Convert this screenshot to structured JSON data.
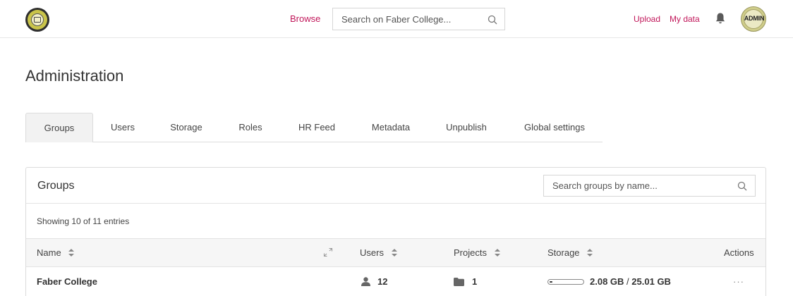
{
  "header": {
    "logo_icon": "college-seal-logo",
    "browse_label": "Browse",
    "search_placeholder": "Search on Faber College...",
    "upload_label": "Upload",
    "mydata_label": "My data",
    "avatar_text": "ADMIN"
  },
  "page": {
    "title": "Administration"
  },
  "tabs": [
    {
      "label": "Groups",
      "active": true
    },
    {
      "label": "Users"
    },
    {
      "label": "Storage"
    },
    {
      "label": "Roles"
    },
    {
      "label": "HR Feed"
    },
    {
      "label": "Metadata"
    },
    {
      "label": "Unpublish"
    },
    {
      "label": "Global settings"
    }
  ],
  "groups_panel": {
    "title": "Groups",
    "search_placeholder": "Search groups by name...",
    "entries_text": "Showing 10 of 11 entries",
    "columns": {
      "name": "Name",
      "users": "Users",
      "projects": "Projects",
      "storage": "Storage",
      "actions": "Actions"
    },
    "rows": [
      {
        "name": "Faber College",
        "users": "12",
        "projects": "1",
        "storage_used": "2.08 GB",
        "storage_sep": "/",
        "storage_total": "25.01 GB",
        "storage_fraction": 0.083,
        "actions": "···"
      }
    ]
  },
  "colors": {
    "accent": "#c1175a",
    "border": "#dcdcdc",
    "tab_active_bg": "#f2f2f2"
  }
}
